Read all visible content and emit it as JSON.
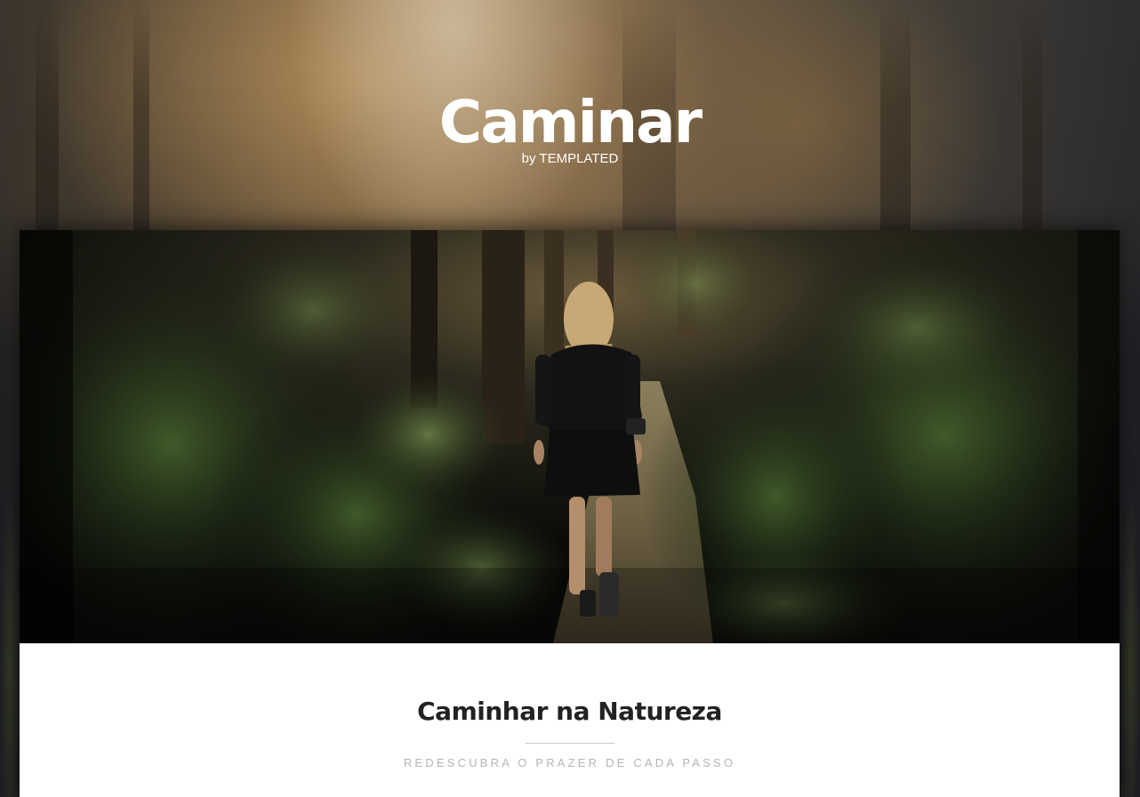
{
  "header": {
    "logo": "Caminar",
    "byline": "by TEMPLATED"
  },
  "hero": {
    "image": "woman-walking-forest-path-photo"
  },
  "intro": {
    "title": "Caminhar na Natureza",
    "subtitle": "REDESCUBRA O PRAZER DE CADA PASSO"
  },
  "colors": {
    "page_background": "#1d1e21",
    "card_background": "#ffffff",
    "title": "#222222",
    "subtitle": "#b5b5b5",
    "divider": "#c8c8c8",
    "header_text": "#ffffff"
  }
}
